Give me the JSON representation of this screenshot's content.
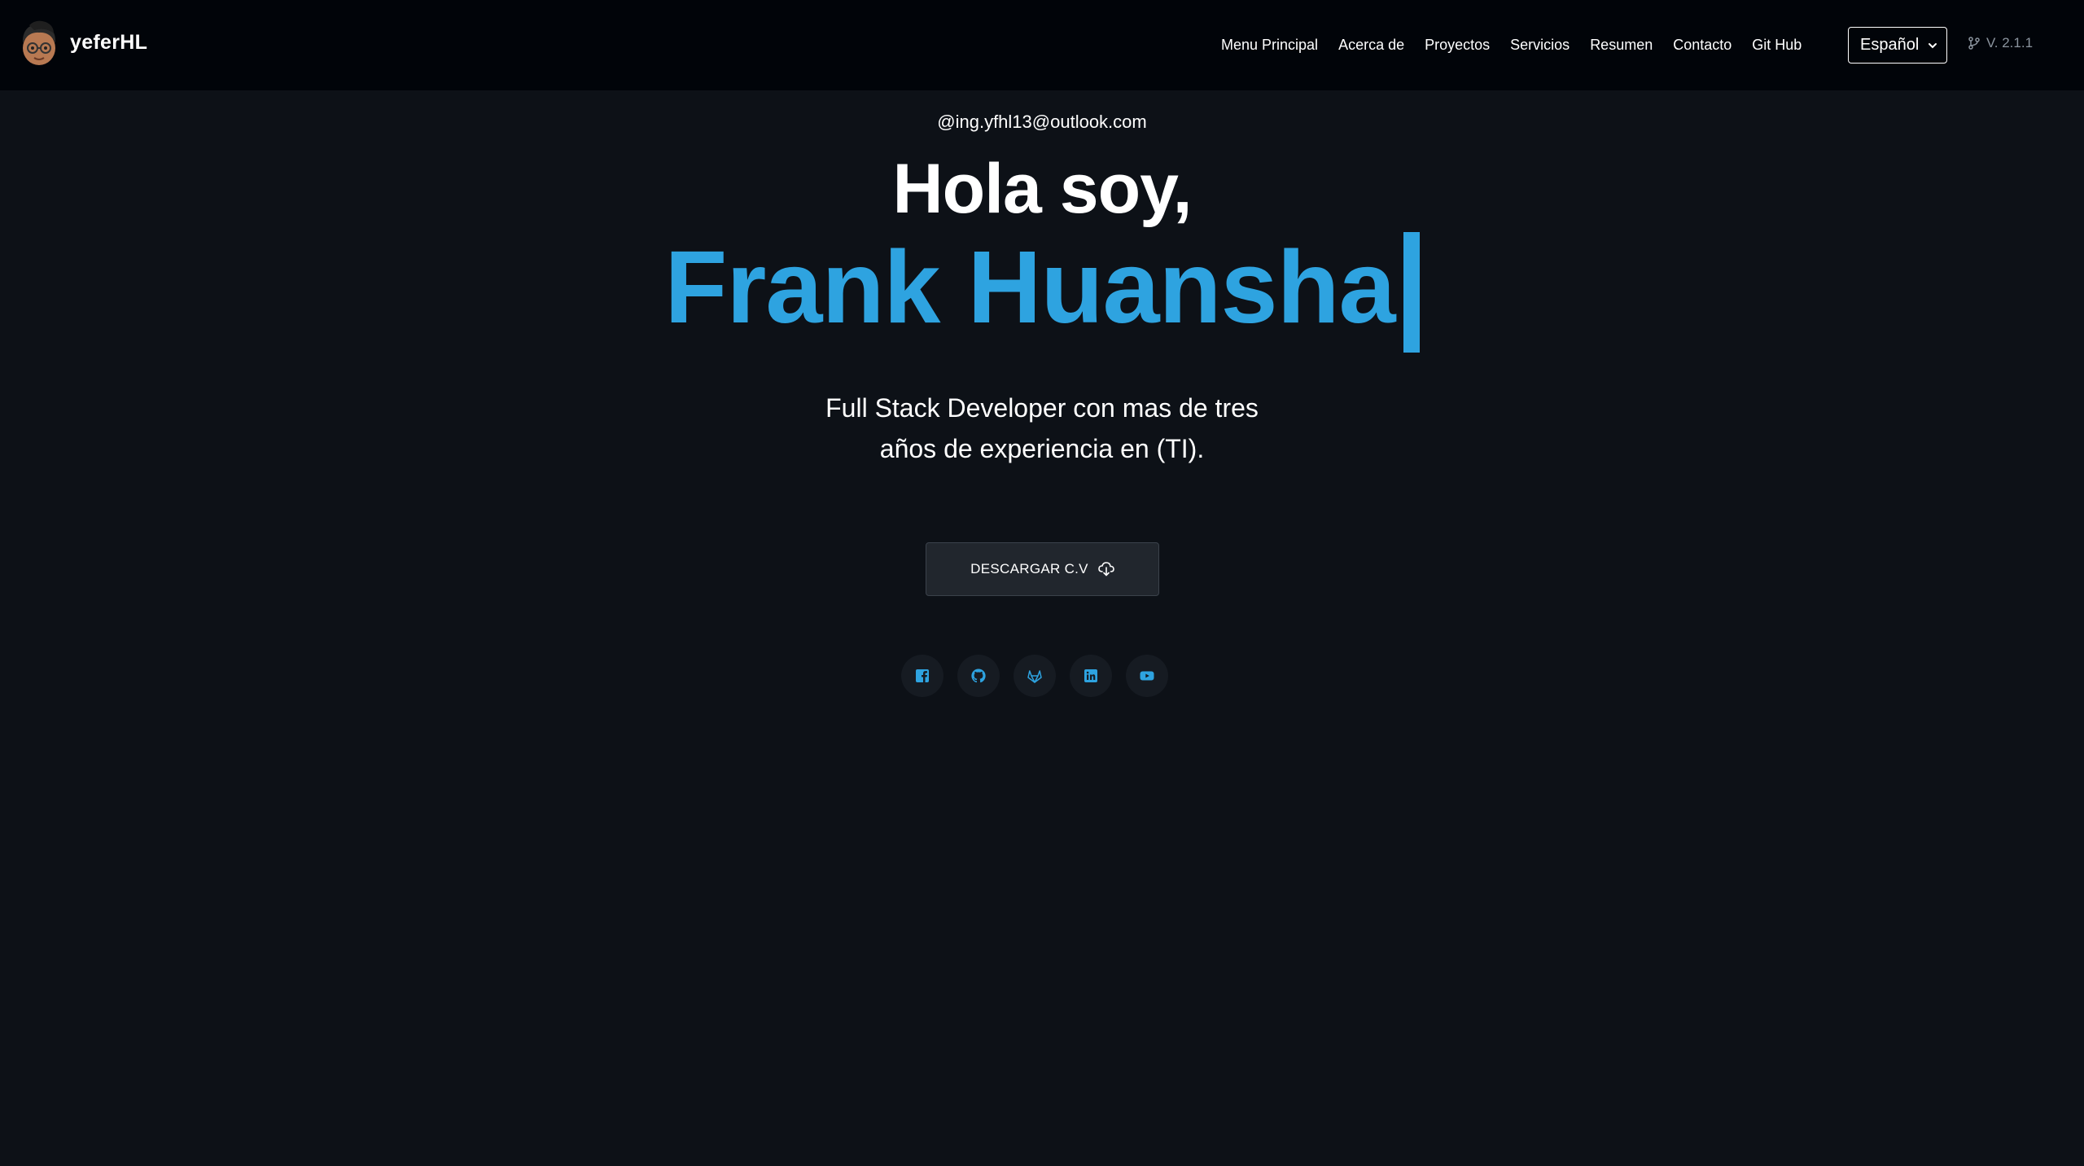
{
  "brand": {
    "name": "yeferHL"
  },
  "nav": {
    "links": [
      {
        "label": "Menu Principal"
      },
      {
        "label": "Acerca de"
      },
      {
        "label": "Proyectos"
      },
      {
        "label": "Servicios"
      },
      {
        "label": "Resumen"
      },
      {
        "label": "Contacto"
      },
      {
        "label": "Git Hub"
      }
    ],
    "language": {
      "selected": "Español"
    },
    "version": "V. 2.1.1"
  },
  "hero": {
    "email": "@ing.yfhl13@outlook.com",
    "greeting": "Hola soy,",
    "name": "Frank Huansha",
    "subtitle_line1": "Full Stack Developer con mas de tres",
    "subtitle_line2": "años de experiencia en (TI).",
    "cv_button": "DESCARGAR C.V"
  },
  "socials": [
    {
      "icon": "facebook-icon"
    },
    {
      "icon": "github-icon"
    },
    {
      "icon": "gitlab-icon"
    },
    {
      "icon": "linkedin-icon"
    },
    {
      "icon": "youtube-icon"
    }
  ],
  "colors": {
    "background": "#0d1117",
    "navbar": "#010409",
    "accent": "#2ea3e0",
    "button": "#21262d",
    "muted": "#8b949e"
  }
}
